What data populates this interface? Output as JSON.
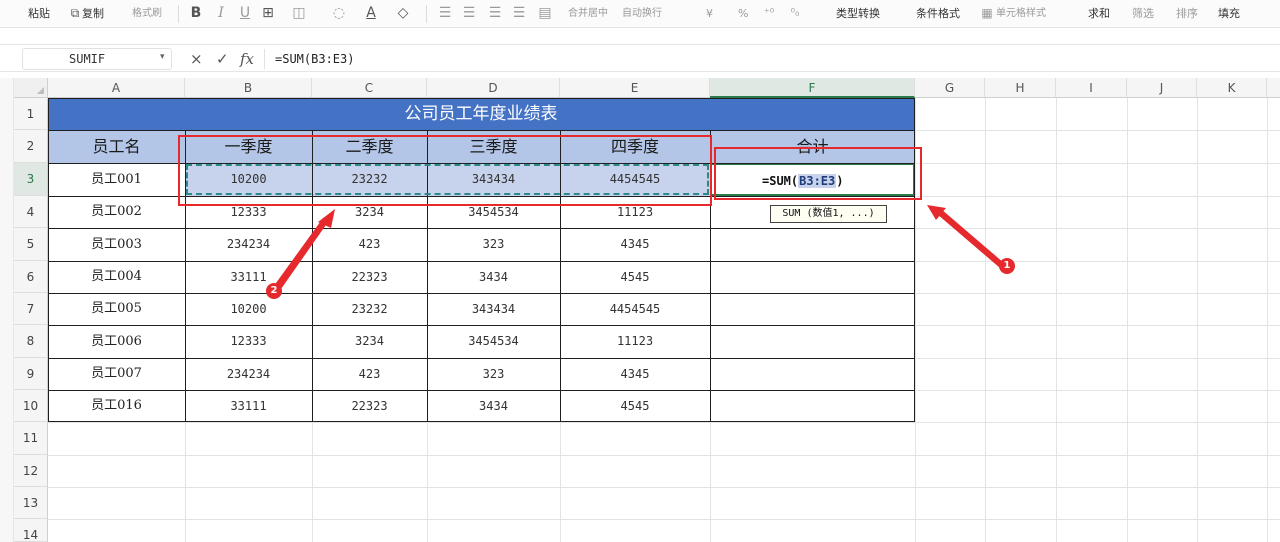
{
  "toolbar": {
    "paste": "粘贴",
    "copy": "复制",
    "format_painter": "格式刷",
    "bold": "B",
    "italic": "I",
    "underline": "U",
    "merge_center": "合并居中",
    "wrap_text": "自动换行",
    "currency": "¥",
    "percent": "%",
    "type_convert": "类型转换",
    "conditional_format": "条件格式",
    "cell_style": "单元格样式",
    "sum": "求和",
    "filter": "筛选",
    "sort": "排序",
    "fill": "填充"
  },
  "formula_bar": {
    "name_box": "SUMIF",
    "cancel": "×",
    "confirm": "✓",
    "fx": "fx",
    "formula": "=SUM(B3:E3)"
  },
  "columns": [
    "A",
    "B",
    "C",
    "D",
    "E",
    "F",
    "G",
    "H",
    "I",
    "J",
    "K"
  ],
  "rows": [
    "1",
    "2",
    "3",
    "4",
    "5",
    "6",
    "7",
    "8",
    "9",
    "10",
    "11",
    "12",
    "13",
    "14"
  ],
  "table": {
    "title": "公司员工年度业绩表",
    "headers": [
      "员工名",
      "一季度",
      "二季度",
      "三季度",
      "四季度",
      "合计"
    ],
    "data": [
      [
        "员工001",
        "10200",
        "23232",
        "343434",
        "4454545"
      ],
      [
        "员工002",
        "12333",
        "3234",
        "3454534",
        "11123"
      ],
      [
        "员工003",
        "234234",
        "423",
        "323",
        "4345"
      ],
      [
        "员工004",
        "33111",
        "22323",
        "3434",
        "4545"
      ],
      [
        "员工005",
        "10200",
        "23232",
        "343434",
        "4454545"
      ],
      [
        "员工006",
        "12333",
        "3234",
        "3454534",
        "11123"
      ],
      [
        "员工007",
        "234234",
        "423",
        "323",
        "4345"
      ],
      [
        "员工016",
        "33111",
        "22323",
        "3434",
        "4545"
      ]
    ]
  },
  "editing": {
    "prefix": "=SUM(",
    "range": "B3:E3",
    "suffix": ")",
    "tooltip": "SUM (数值1, ...)"
  },
  "annotations": {
    "callout_1": "1",
    "callout_2": "2",
    "color": "#e5292c"
  },
  "colors": {
    "title_band": "#4472c4",
    "header_fill": "#b4c6e7",
    "selection_fill": "#c7d2ec",
    "active_cell": "#2a7a4a"
  }
}
